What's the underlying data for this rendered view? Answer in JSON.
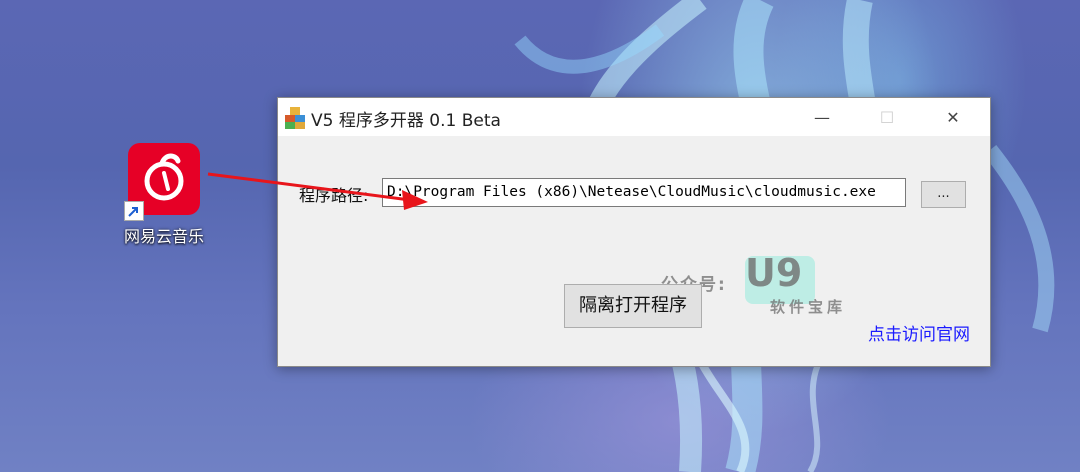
{
  "desktop": {
    "icon_label": "网易云音乐"
  },
  "window": {
    "title": "V5 程序多开器 0.1 Beta",
    "controls": {
      "minimize": "—",
      "maximize": "☐",
      "close": "✕"
    },
    "path_label": "程序路径:",
    "path_value": "D:\\Program Files (x86)\\Netease\\CloudMusic\\cloudmusic.exe",
    "browse_label": "...",
    "launch_label": "隔离打开程序",
    "visit_link": "点击访问官网"
  },
  "watermark": {
    "prefix": "公众号:",
    "logo": "U9",
    "sub": "软件宝库"
  },
  "colors": {
    "app_icon_bg": "#e60026",
    "arrow": "#e8151b",
    "link": "#1a1aff"
  }
}
